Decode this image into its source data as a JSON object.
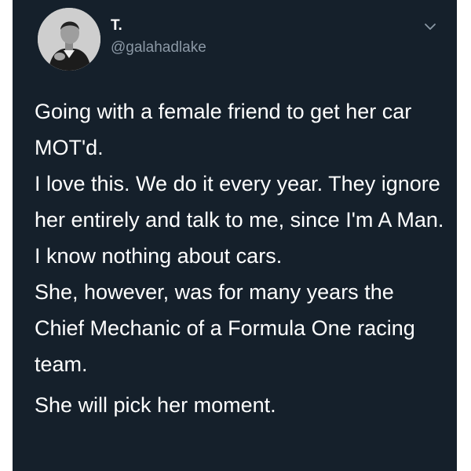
{
  "user": {
    "display_name": "T.",
    "handle": "@galahadlake"
  },
  "tweet": {
    "paragraphs": [
      "Going with a female friend to get her car MOT'd.",
      "I love this. We do it every year. They ignore her entirely and talk to me, since I'm A Man. I know nothing about cars.",
      "She, however, was for many years the Chief Mechanic of a Formula One racing team.",
      "She will pick her moment."
    ]
  },
  "icons": {
    "menu": "chevron-down-icon",
    "avatar": "profile-photo"
  },
  "colors": {
    "background": "#15202b",
    "text": "#ffffff",
    "secondary_text": "#8b98a5"
  }
}
